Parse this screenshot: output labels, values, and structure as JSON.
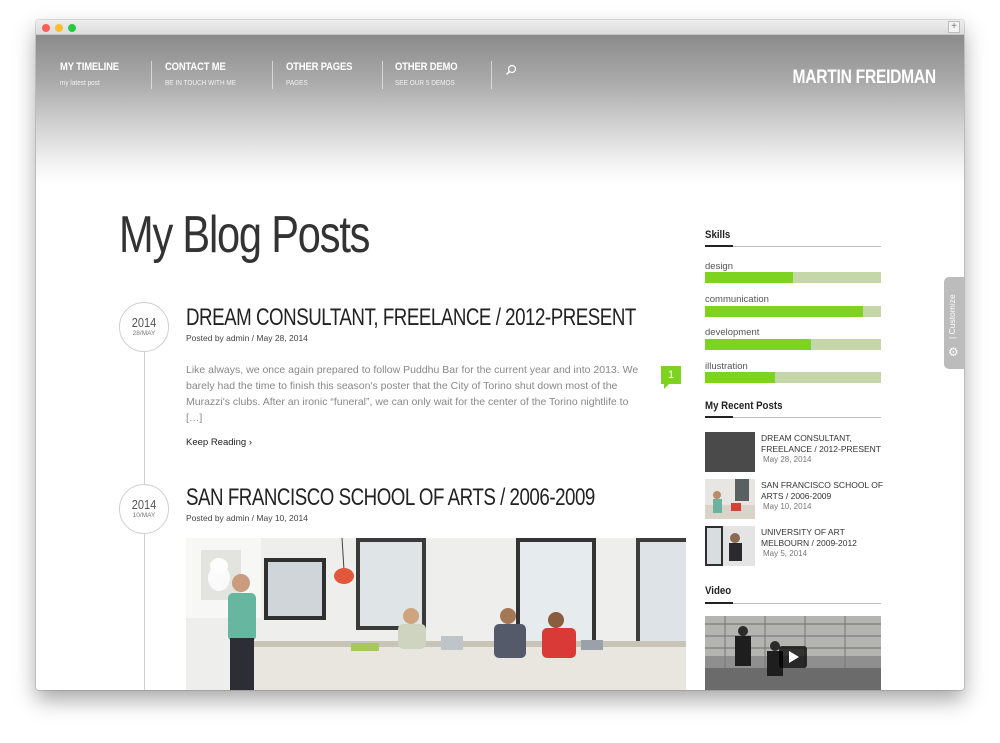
{
  "window": {
    "plus_icon": "+"
  },
  "nav": {
    "items": [
      {
        "title": "MY TIMELINE",
        "subtitle": "my latest post"
      },
      {
        "title": "CONTACT ME",
        "subtitle": "BE IN TOUCH WITH ME"
      },
      {
        "title": "OTHER PAGES",
        "subtitle": "PAGES"
      },
      {
        "title": "OTHER DEMO",
        "subtitle": "SEE OUR 5 DEMOS"
      }
    ],
    "search_icon": "search-icon"
  },
  "brand": "MARTIN FREIDMAN",
  "main": {
    "title": "My Blog Posts",
    "posts": [
      {
        "year": "2014",
        "day": "28/MAY",
        "title": "DREAM CONSULTANT, FREELANCE / 2012-PRESENT",
        "meta": "Posted by admin / May 28, 2014",
        "excerpt": "Like always, we once again prepared to follow Puddhu Bar for the current year and into 2013. We barely had the time to finish this season's poster that the City of Torino shut down most of the Murazzi's clubs. After an ironic “funeral”, we can only wait for the center of the Torino nightlife to […]",
        "read_more": "Keep Reading ›",
        "comments": "1"
      },
      {
        "year": "2014",
        "day": "10/MAY",
        "title": "SAN FRANCISCO SCHOOL OF ARTS / 2006-2009",
        "meta": "Posted by admin / May 10, 2014"
      }
    ]
  },
  "sidebar": {
    "skills_title": "Skills",
    "skills": [
      {
        "label": "design",
        "value": 0.5
      },
      {
        "label": "communication",
        "value": 0.9
      },
      {
        "label": "development",
        "value": 0.6
      },
      {
        "label": "illustration",
        "value": 0.4
      }
    ],
    "recent_title": "My Recent Posts",
    "recent_posts": [
      {
        "title": "DREAM CONSULTANT, FREELANCE / 2012-PRESENT",
        "date": "May 28, 2014"
      },
      {
        "title": "SAN FRANCISCO SCHOOL OF ARTS / 2006-2009",
        "date": "May 10, 2014"
      },
      {
        "title": "UNIVERSITY OF ART MELBOURN / 2009-2012",
        "date": "May 5, 2014"
      }
    ],
    "video_title": "Video"
  },
  "customize": {
    "label": "Customize"
  },
  "colors": {
    "accent": "#7ed321",
    "skill_track": "#c5d6a8",
    "title_text": "#333333"
  }
}
